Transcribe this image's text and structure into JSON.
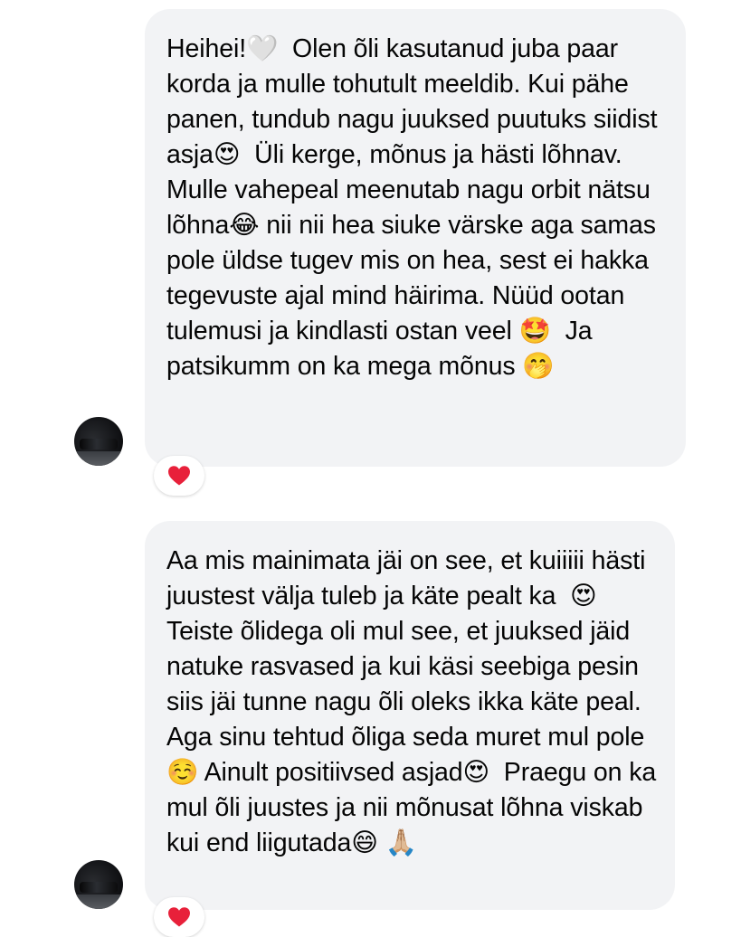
{
  "messages": [
    {
      "text": "Heihei!🤍  Olen õli kasutanud juba paar korda ja mulle tohutult meeldib. Kui pähe panen, tundub nagu juuksed puutuks siidist asja😍  Üli kerge, mõnus ja hästi lõhnav. Mulle vahepeal meenutab nagu orbit nätsu lõhna😂 nii nii hea siuke värske aga samas pole üldse tugev mis on hea, sest ei hakka tegevuste ajal mind häirima. Nüüd ootan tulemusi ja kindlasti ostan veel 🤩  Ja patsikumm on ka mega mõnus 🤭",
      "reaction": "heart-icon"
    },
    {
      "text": "Aa mis mainimata jäi on see, et kuiiiii hästi juustest välja tuleb ja käte pealt ka  😍  Teiste õlidega oli mul see, et juuksed jäid natuke rasvased ja kui käsi seebiga pesin siis jäi tunne nagu õli oleks ikka käte peal. Aga sinu tehtud õliga seda muret mul pole☺️ Ainult positiivsed asjad😍  Praegu on ka mul õli juustes ja nii mõnusat lõhna viskab kui end liigutada😄 🙏🏼",
      "reaction": "heart-icon"
    }
  ],
  "colors": {
    "bubble": "#f2f3f5",
    "text": "#050505",
    "reaction_heart": "#e8203a"
  }
}
